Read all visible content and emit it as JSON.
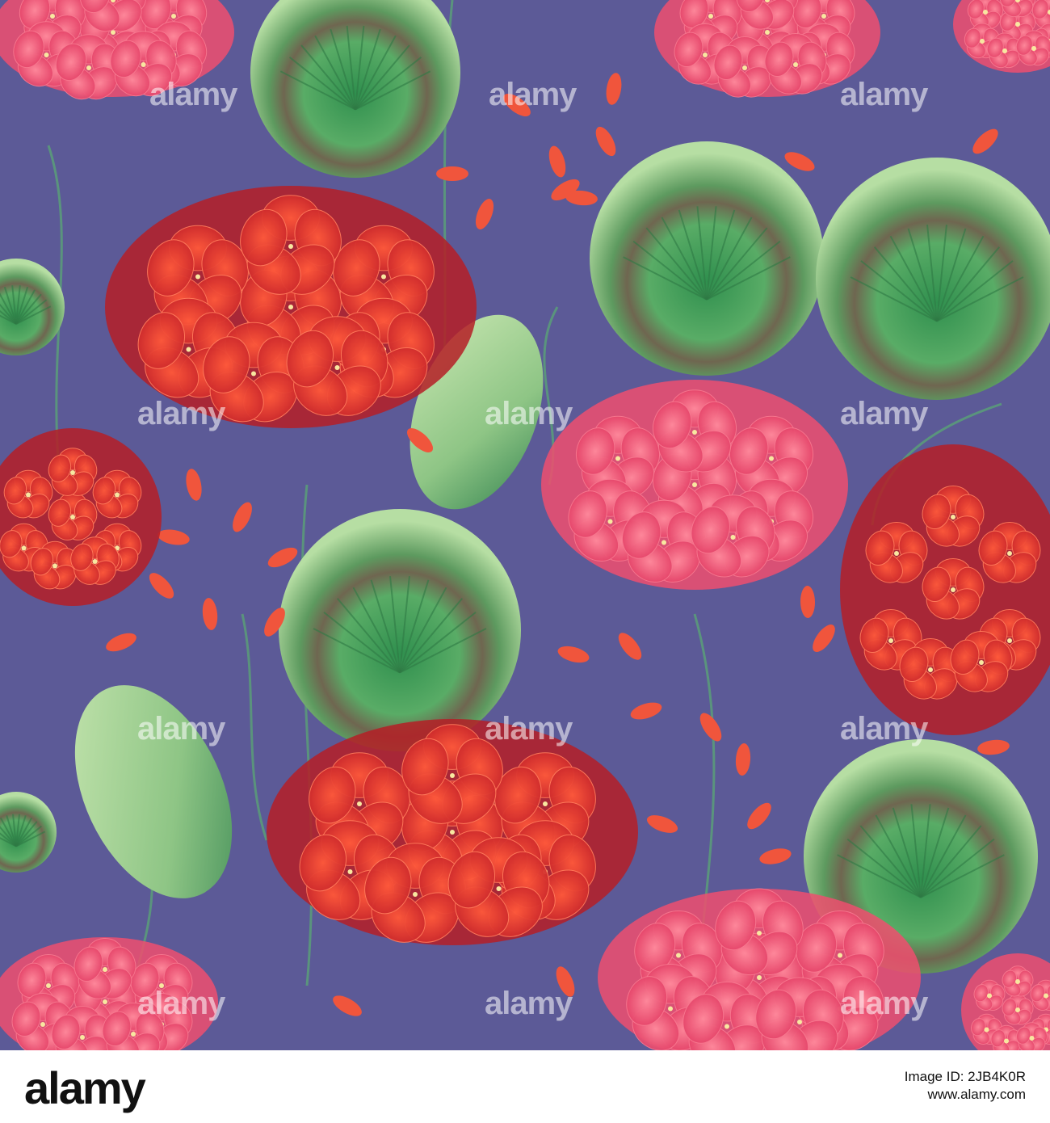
{
  "image": {
    "background_color": "#5c5a97",
    "subject": "seamless watercolor geranium pattern",
    "colors": {
      "red_flower": "#e0382f",
      "red_flower_dark": "#b51e26",
      "pink_flower": "#ee4f6e",
      "pink_flower_light": "#f7788f",
      "leaf_light": "#a8d69a",
      "leaf_mid": "#5fae6a",
      "leaf_band": "#7a6a52",
      "stem": "#4d8a6a",
      "bud": "#f0553c"
    }
  },
  "watermark": {
    "text": "alamy"
  },
  "footer": {
    "logo": "alamy",
    "image_id": "Image ID: 2JB4K0R",
    "url": "www.alamy.com"
  }
}
